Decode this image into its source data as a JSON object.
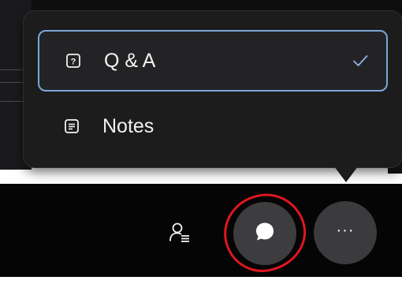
{
  "menu": {
    "items": [
      {
        "label": "Q & A",
        "icon": "question-box-icon",
        "selected": true
      },
      {
        "label": "Notes",
        "icon": "notes-icon",
        "selected": false
      }
    ]
  },
  "toolbar": {
    "buttons": [
      {
        "icon": "people-icon"
      },
      {
        "icon": "chat-bubble-icon",
        "highlighted": true
      },
      {
        "icon": "more-icon",
        "glyph": "···"
      }
    ]
  },
  "colors": {
    "popup_bg": "#1c1c1d",
    "toolbar_bg": "#050505",
    "selection_border": "#7aa7d8",
    "annotation_red": "#e0161f"
  }
}
